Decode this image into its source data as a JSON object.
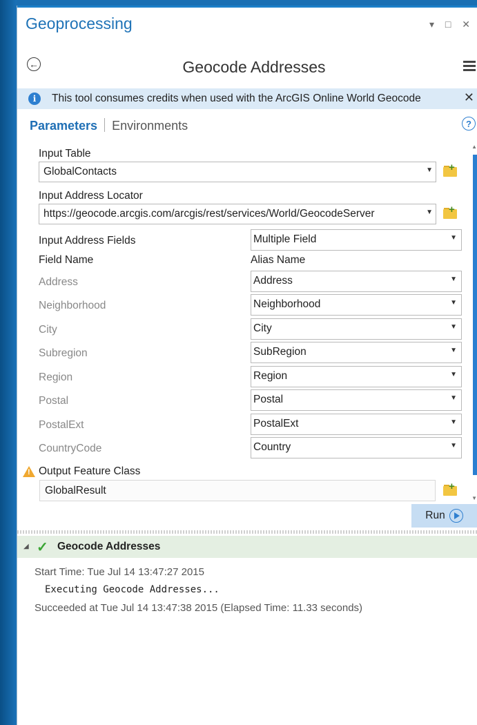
{
  "pane": {
    "title": "Geoprocessing",
    "window_controls": "▾ □ ✕",
    "tool_title": "Geocode Addresses",
    "info_banner": "This tool consumes credits when used with the ArcGIS Online World Geocode",
    "tabs": [
      {
        "label": "Parameters",
        "active": true
      },
      {
        "label": "Environments",
        "active": false
      }
    ]
  },
  "params": {
    "input_table_label": "Input Table",
    "input_table_value": "GlobalContacts",
    "locator_label": "Input Address Locator",
    "locator_value": "https://geocode.arcgis.com/arcgis/rest/services/World/GeocodeServer",
    "address_fields_label": "Input Address Fields",
    "address_fields_value": "Multiple Field",
    "field_name_header": "Field Name",
    "alias_name_header": "Alias Name",
    "field_map": [
      {
        "field": "Address",
        "alias": "Address"
      },
      {
        "field": "Neighborhood",
        "alias": "Neighborhood"
      },
      {
        "field": "City",
        "alias": "City"
      },
      {
        "field": "Subregion",
        "alias": "SubRegion"
      },
      {
        "field": "Region",
        "alias": "Region"
      },
      {
        "field": "Postal",
        "alias": "Postal"
      },
      {
        "field": "PostalExt",
        "alias": "PostalExt"
      },
      {
        "field": "CountryCode",
        "alias": "Country"
      }
    ],
    "output_label": "Output Feature Class",
    "output_value": "GlobalResult",
    "run_label": "Run"
  },
  "result": {
    "title": "Geocode Addresses",
    "status": "succeeded",
    "messages": [
      "Start Time: Tue Jul 14 13:47:27 2015",
      "Executing Geocode Addresses...",
      "Succeeded at Tue Jul 14 13:47:38 2015 (Elapsed Time: 11.33 seconds)"
    ]
  },
  "colors": {
    "accent": "#1f73b7",
    "success": "#3aa534",
    "warning": "#f0a830",
    "info_banner": "#dbeaf7"
  }
}
